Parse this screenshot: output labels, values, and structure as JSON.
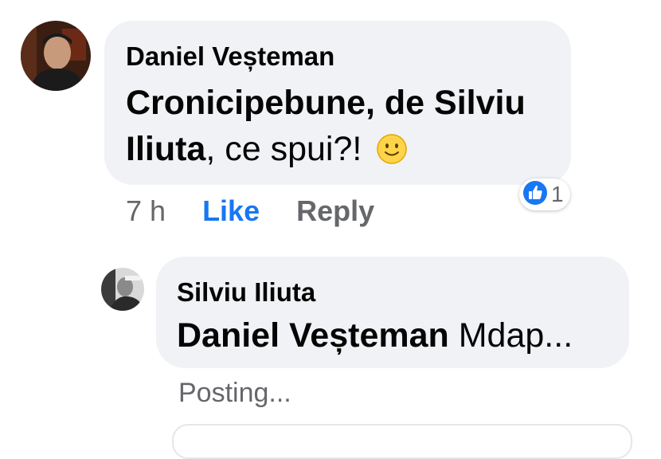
{
  "comments": [
    {
      "author": "Daniel Veșteman",
      "mention": "Cronicipebune, de Silviu Iliuta",
      "mention_line1": "Cronicipebune, de Silviu",
      "mention_line2": "Iliuta",
      "text": ", ce spui?!",
      "emoji": "slightly-smiling-face",
      "time": "7 h",
      "like_label": "Like",
      "reply_label": "Reply",
      "reaction": {
        "icon": "thumbs-up-icon",
        "count": "1"
      }
    },
    {
      "author": "Silviu Iliuta",
      "mention": "Daniel Veșteman",
      "text": "Mdap...",
      "status": "Posting..."
    }
  ],
  "colors": {
    "bubble": "#f0f2f5",
    "link_blue": "#1877f2",
    "meta_gray": "#65676b"
  }
}
